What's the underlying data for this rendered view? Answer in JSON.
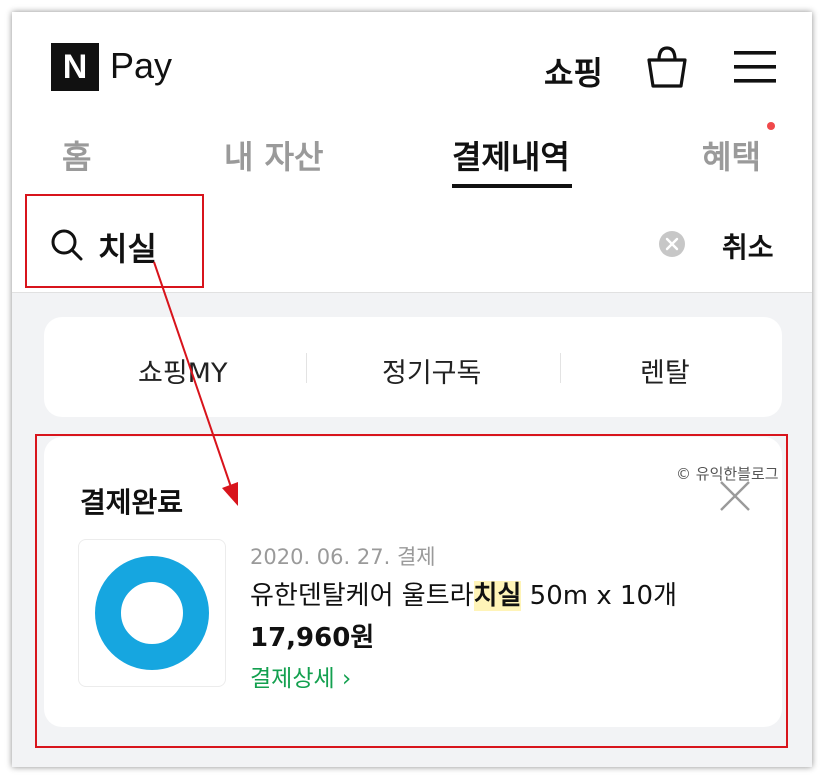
{
  "header": {
    "logo_mark": "N",
    "logo_text": "Pay",
    "shopping_label": "쇼핑",
    "bag_icon": "shopping-bag-icon",
    "menu_icon": "hamburger-menu-icon"
  },
  "tabs": [
    {
      "label": "홈"
    },
    {
      "label": "내 자산"
    },
    {
      "label": "결제내역"
    },
    {
      "label": "혜택"
    }
  ],
  "search": {
    "value": "치실",
    "cancel_label": "취소"
  },
  "filters": [
    {
      "label": "쇼핑MY"
    },
    {
      "label": "정기구독"
    },
    {
      "label": "렌탈"
    }
  ],
  "order": {
    "status": "결제완료",
    "date": "2020. 06. 27. 결제",
    "product_prefix": "유한덴탈케어 울트라",
    "product_highlight": "치실",
    "product_suffix": " 50m x 10개",
    "price": "17,960원",
    "detail_label": "결제상세",
    "detail_chevron": "›",
    "watermark": "© 유익한블로그"
  },
  "colors": {
    "accent_green": "#13a04f",
    "annotation_red": "#d8141c",
    "highlight_yellow": "#fff4b8",
    "notification_dot": "#f0494b",
    "thumb_ring": "#16a6e0"
  }
}
